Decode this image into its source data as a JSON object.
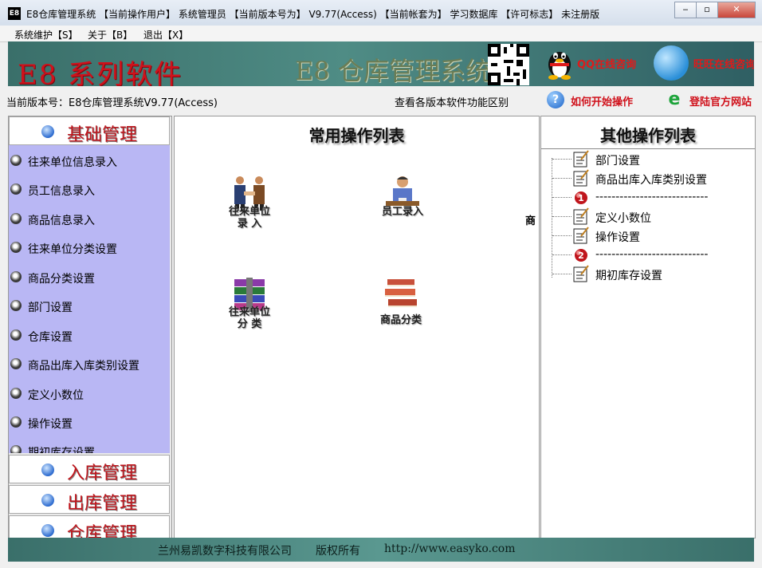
{
  "titlebar": {
    "icon_text": "E8",
    "title": "E8仓库管理系统  【当前操作用户】 系统管理员   【当前版本号为】 V9.77(Access)    【当前帐套为】 学习数据库    【许可标志】  未注册版",
    "minimize": "‒",
    "maximize": "▫",
    "close": "✕"
  },
  "menu": {
    "items": [
      "系统维护【S】",
      "关于【B】",
      "退出【X】"
    ]
  },
  "banner": {
    "title": "E8 系列软件",
    "subtitle": "E8 仓库管理系统",
    "qq_text": "QQ在线咨询",
    "online_text": "旺旺在线咨询"
  },
  "infobar": {
    "version": "当前版本号：E8仓库管理系统V9.77(Access)",
    "compare": "查看各版本软件功能区别",
    "help": "如何开始操作",
    "login": "登陆官方网站"
  },
  "left": {
    "sections": {
      "basic": "基础管理",
      "inbound": "入库管理",
      "outbound": "出库管理",
      "warehouse": "仓库管理"
    },
    "items": [
      "往来单位信息录入",
      "员工信息录入",
      "商品信息录入",
      "往来单位分类设置",
      "商品分类设置",
      "部门设置",
      "仓库设置",
      "商品出库入库类别设置",
      "定义小数位",
      "操作设置",
      "期初库存设置"
    ]
  },
  "center": {
    "title": "常用操作列表",
    "tiles": [
      {
        "line1": "往来单位",
        "line2": "录  入"
      },
      {
        "line1": "员工录入",
        "line2": ""
      },
      {
        "line1": "往来单位",
        "line2": "分  类"
      },
      {
        "line1": "商品分类",
        "line2": ""
      }
    ],
    "clipped": "商"
  },
  "right": {
    "title": "其他操作列表",
    "items": [
      {
        "text": "部门设置",
        "icon": "notepad-icon"
      },
      {
        "text": "商品出库入库类别设置",
        "icon": "notepad-icon"
      },
      {
        "text": "----------------------------",
        "icon": "number-1-icon"
      },
      {
        "text": "定义小数位",
        "icon": "notepad-icon"
      },
      {
        "text": "操作设置",
        "icon": "notepad-icon"
      },
      {
        "text": "----------------------------",
        "icon": "number-2-icon"
      },
      {
        "text": "期初库存设置",
        "icon": "notepad-icon"
      }
    ],
    "badges": [
      "1",
      "2"
    ]
  },
  "footer": {
    "company": "兰州易凯数字科技有限公司",
    "rights": "版权所有",
    "url": "http://www.easyko.com"
  }
}
